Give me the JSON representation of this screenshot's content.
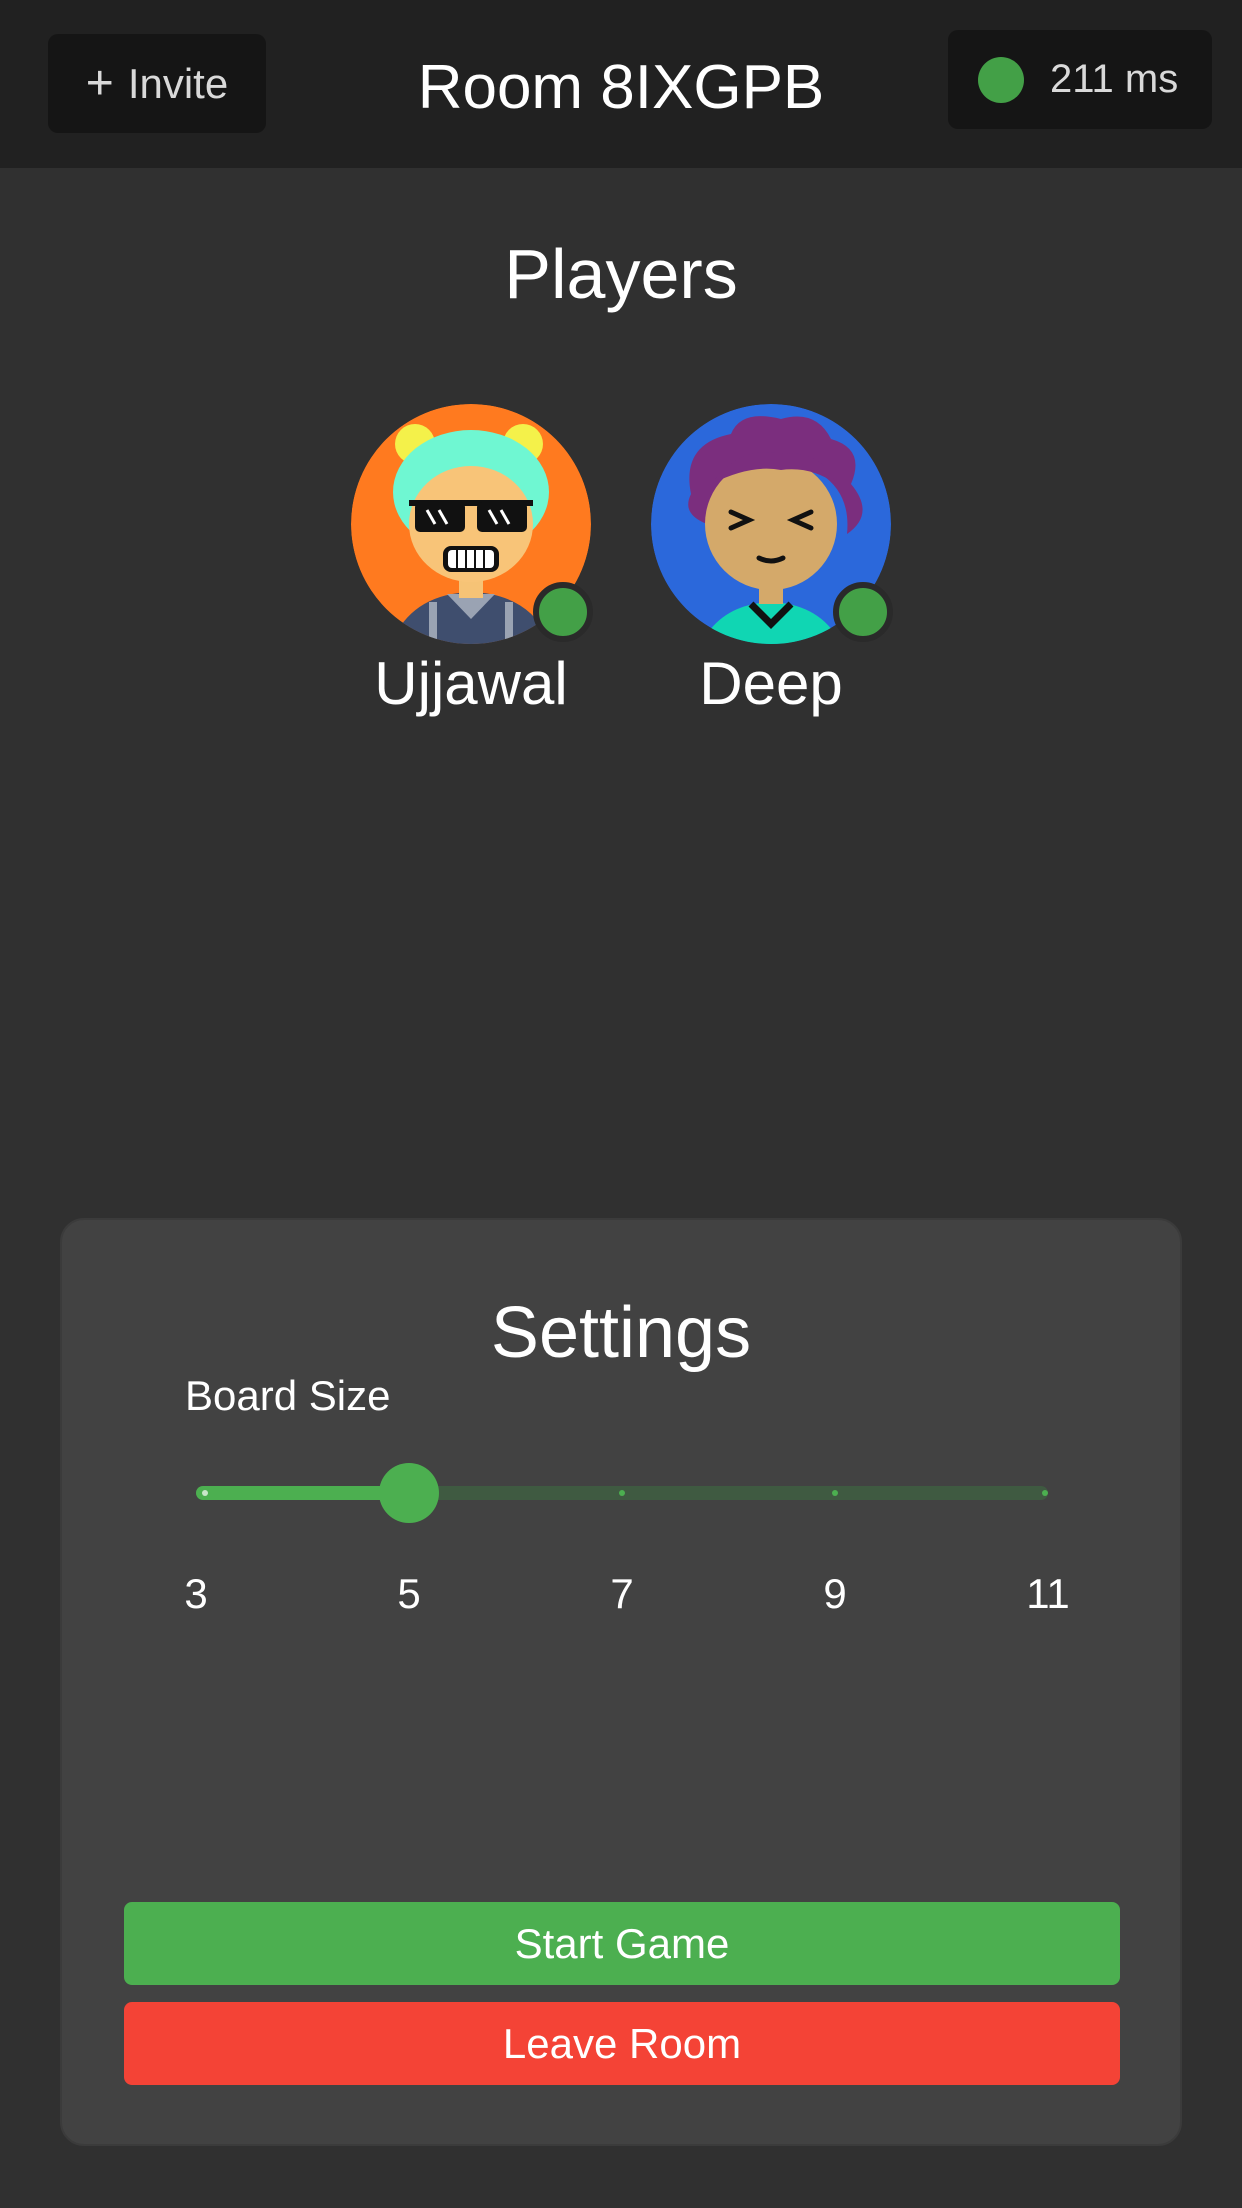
{
  "header": {
    "invite_label": "Invite",
    "room_title": "Room 8IXGPB",
    "ping_text": "211 ms"
  },
  "players": {
    "title": "Players",
    "list": [
      {
        "name": "Ujjawal",
        "online": true,
        "avatar_bg": "#ff7a1f"
      },
      {
        "name": "Deep",
        "online": true,
        "avatar_bg": "#2b68db"
      }
    ]
  },
  "settings": {
    "title": "Settings",
    "board_size": {
      "label": "Board Size",
      "min": 3,
      "max": 11,
      "step": 2,
      "value": 5,
      "marks": [
        "3",
        "5",
        "7",
        "9",
        "11"
      ]
    },
    "start_label": "Start Game",
    "leave_label": "Leave Room"
  },
  "colors": {
    "accent_green": "#4caf50",
    "danger_red": "#f44336",
    "online_green": "#43a047"
  }
}
